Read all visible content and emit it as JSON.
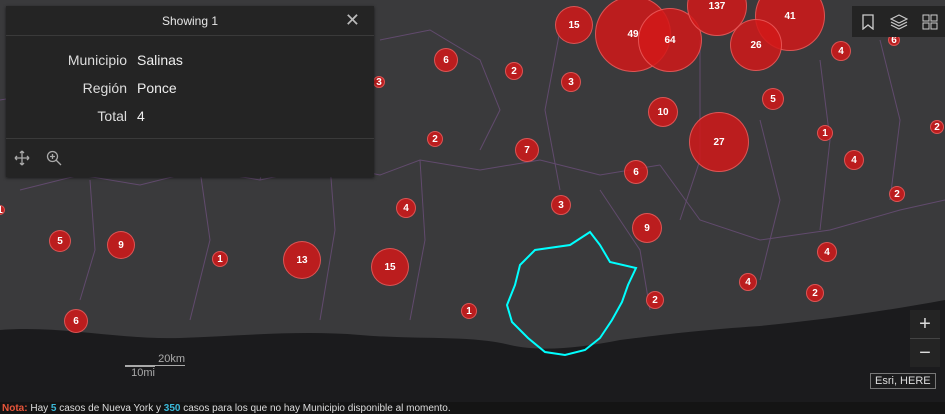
{
  "popup": {
    "title": "Showing 1",
    "rows": [
      {
        "key": "Municipio",
        "value": "Salinas"
      },
      {
        "key": "Región",
        "value": "Ponce"
      },
      {
        "key": "Total",
        "value": "4"
      }
    ]
  },
  "bubbles": [
    "15",
    "49",
    "64",
    "137",
    "41",
    "26",
    "4",
    "6",
    "2",
    "3",
    "10",
    "5",
    "27",
    "1",
    "4",
    "2",
    "7",
    "6",
    "3",
    "9",
    "2",
    "4",
    "5",
    "9",
    "1",
    "13",
    "15",
    "4",
    "1",
    "4",
    "2",
    "2",
    "6",
    "1",
    "3",
    "2",
    "6"
  ],
  "scale": {
    "km": "20km",
    "mi": "10mi"
  },
  "attribution": "Esri, HERE",
  "footer": {
    "prefix": "Nota:",
    "t1": " Hay ",
    "n1": "5",
    "t2": " casos de Nueva York y ",
    "n2": "350",
    "t3": " casos para los que no hay Municipio disponible al momento."
  },
  "colors": {
    "bubble": "#d21919",
    "highlight": "#00ffff",
    "map": "#3a3a3c",
    "sea": "#1b1b1d"
  }
}
